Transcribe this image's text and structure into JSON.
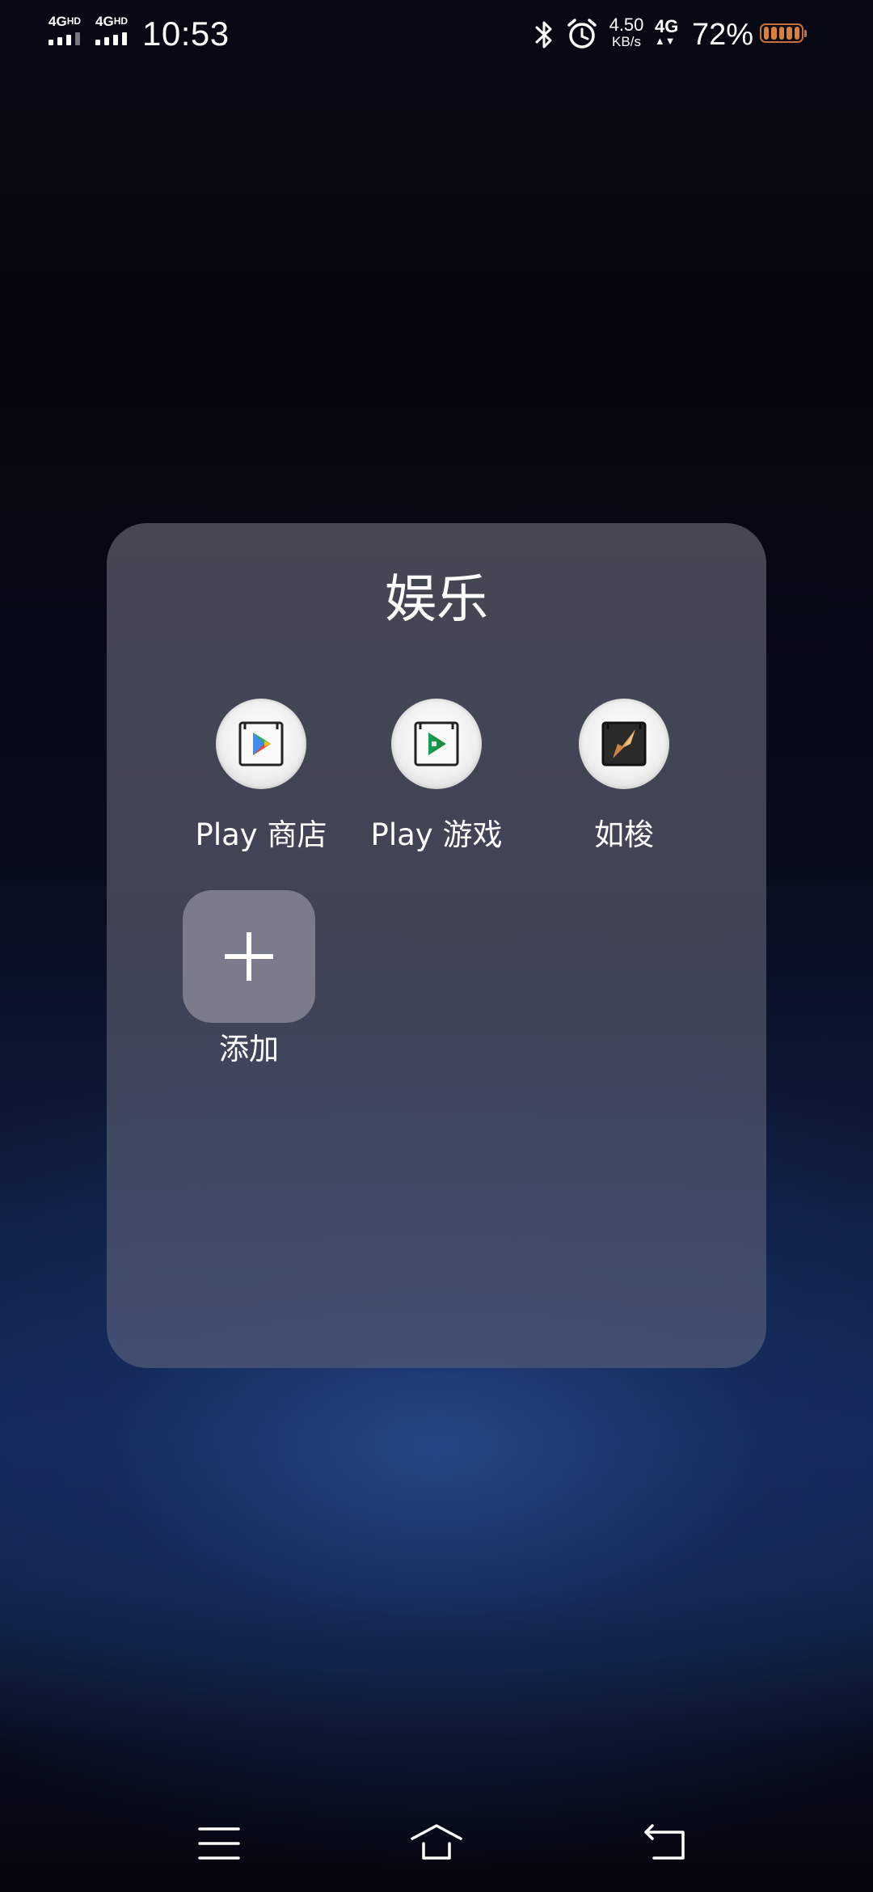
{
  "status_bar": {
    "sim1_network": "4G",
    "sim1_suffix": "HD",
    "sim2_network": "4G",
    "sim2_suffix": "HD",
    "time": "10:53",
    "bluetooth_icon": "bluetooth-icon",
    "alarm_icon": "alarm-icon",
    "net_speed_value": "4.50",
    "net_speed_unit": "KB/s",
    "data_network": "4G",
    "battery_percent": "72%",
    "battery_level": 0.72,
    "battery_color": "#d8803c"
  },
  "folder": {
    "title": "娱乐",
    "apps": [
      {
        "label": "Play 商店",
        "icon": "play-store-icon"
      },
      {
        "label": "Play 游戏",
        "icon": "play-games-icon"
      },
      {
        "label": "如梭",
        "icon": "rusuo-icon"
      }
    ],
    "add": {
      "label": "添加",
      "icon": "plus-icon"
    }
  },
  "nav_bar": {
    "menu_icon": "menu-icon",
    "home_icon": "home-icon",
    "back_icon": "back-icon"
  }
}
